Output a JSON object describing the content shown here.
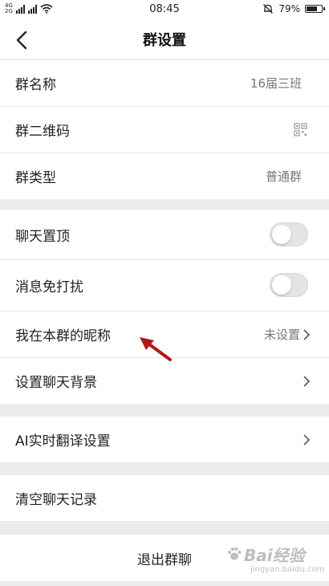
{
  "status_bar": {
    "carrier1": "4G",
    "carrier2": "2G",
    "time": "08:45",
    "battery": "79%",
    "battery_level": 0.79
  },
  "nav": {
    "title": "群设置"
  },
  "group1": [
    {
      "label": "群名称",
      "value": "16届三班"
    },
    {
      "label": "群二维码"
    },
    {
      "label": "群类型",
      "value": "普通群"
    }
  ],
  "group2": [
    {
      "label": "聊天置顶",
      "toggle": false
    },
    {
      "label": "消息免打扰",
      "toggle": false
    },
    {
      "label": "我在本群的昵称",
      "value": "未设置"
    },
    {
      "label": "设置聊天背景"
    }
  ],
  "group3": [
    {
      "label": "AI实时翻译设置"
    }
  ],
  "group4": [
    {
      "label": "清空聊天记录"
    }
  ],
  "exit_label": "退出群聊",
  "watermark": {
    "main": "Bai经验",
    "sub": "jingyan.baidu.com"
  },
  "colors": {
    "annotation_arrow": "#b01818",
    "background": "#ececec"
  }
}
